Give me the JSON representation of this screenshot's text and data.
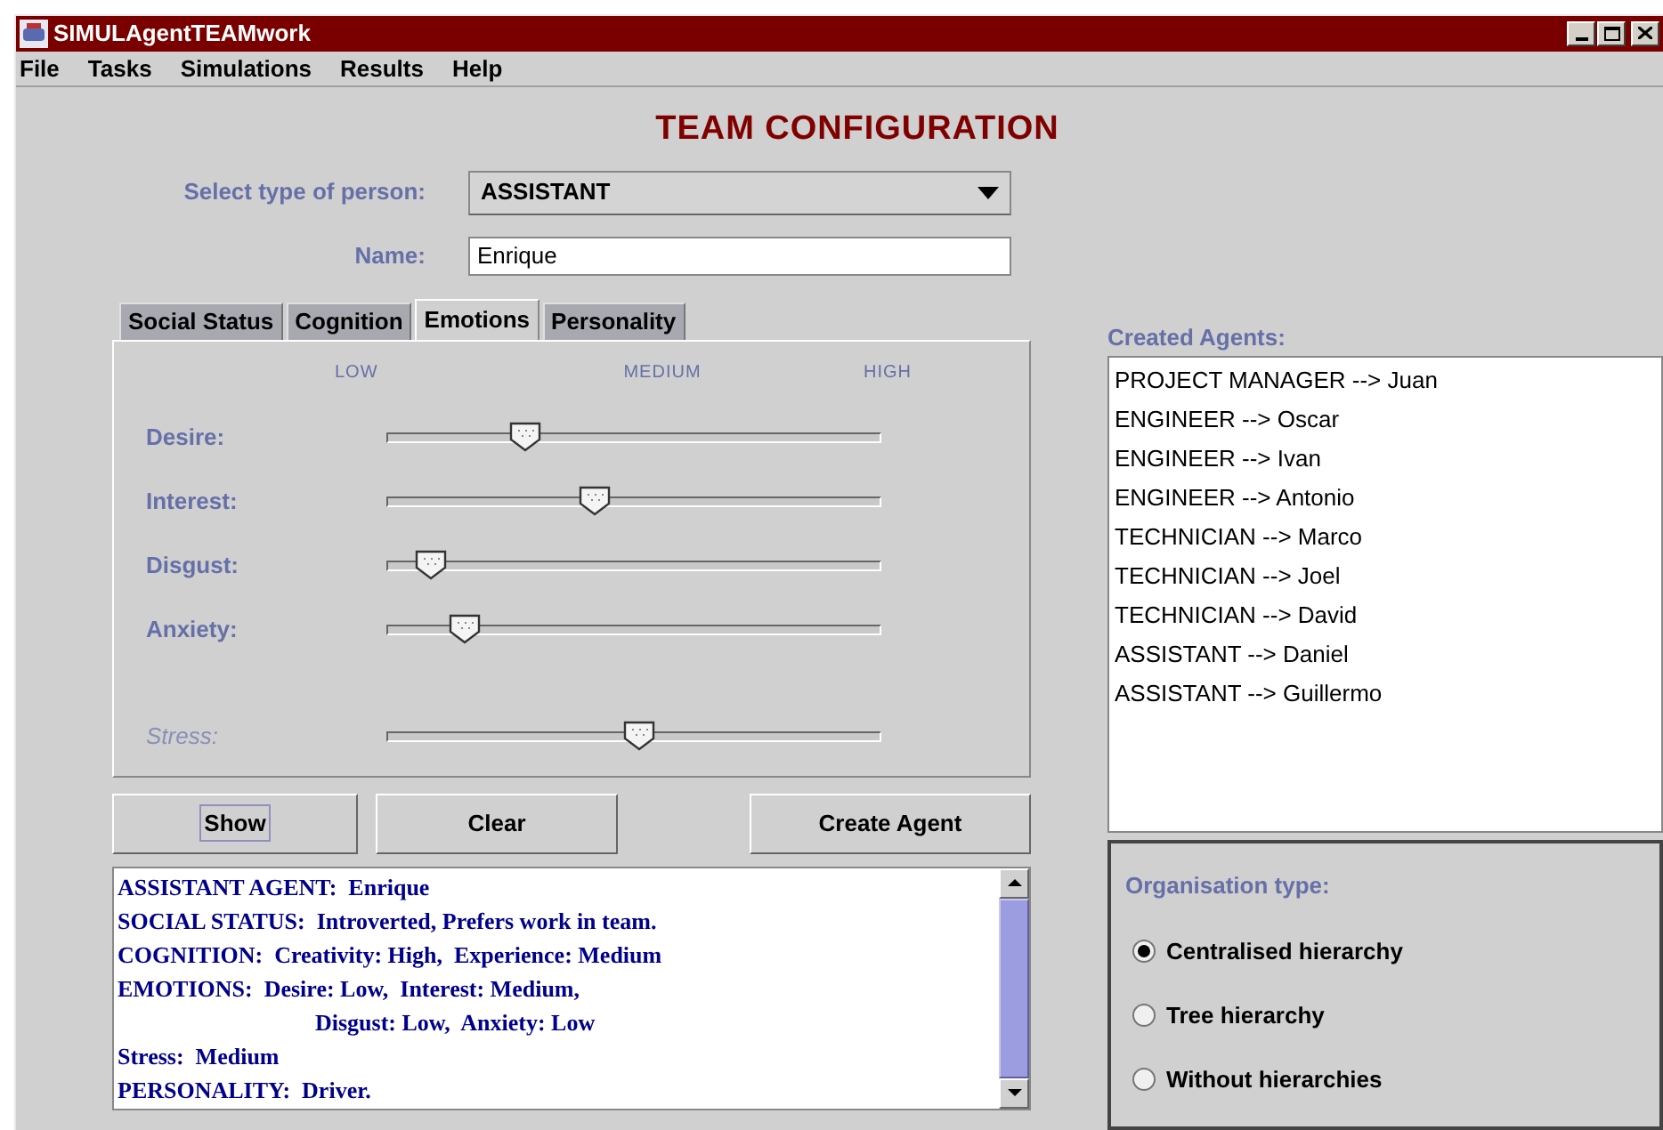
{
  "window": {
    "title": "SIMULAgentTEAMwork"
  },
  "menu": [
    "File",
    "Tasks",
    "Simulations",
    "Results",
    "Help"
  ],
  "heading": "TEAM CONFIGURATION",
  "person_type": {
    "label": "Select type of person:",
    "value": "ASSISTANT"
  },
  "name": {
    "label": "Name:",
    "value": "Enrique"
  },
  "tabs": [
    {
      "label": "Social Status",
      "selected": false
    },
    {
      "label": "Cognition",
      "selected": false
    },
    {
      "label": "Emotions",
      "selected": true
    },
    {
      "label": "Personality",
      "selected": false
    }
  ],
  "scale_labels": [
    "LOW",
    "MEDIUM",
    "HIGH"
  ],
  "sliders": [
    {
      "label": "Desire:",
      "level": 0.28,
      "disabled": false
    },
    {
      "label": "Interest:",
      "level": 0.42,
      "disabled": false
    },
    {
      "label": "Disgust:",
      "level": 0.09,
      "disabled": false
    },
    {
      "label": "Anxiety:",
      "level": 0.16,
      "disabled": false
    },
    {
      "label": "Stress:",
      "level": 0.51,
      "disabled": true
    }
  ],
  "buttons": [
    {
      "label": "Show",
      "focused": true
    },
    {
      "label": "Clear",
      "focused": false
    },
    {
      "label": "Create Agent",
      "focused": false
    }
  ],
  "summary": [
    {
      "text": "ASSISTANT AGENT:  Enrique",
      "kind": "line"
    },
    {
      "text": "SOCIAL STATUS:  Introverted, Prefers work in team.",
      "kind": "line"
    },
    {
      "text": "COGNITION:  Creativity: High,  Experience: Medium",
      "kind": "line"
    },
    {
      "text": "EMOTIONS:  Desire: Low,  Interest: Medium,",
      "kind": "line"
    },
    {
      "text": "Disgust: Low,  Anxiety: Low",
      "kind": "continuation"
    },
    {
      "text": "Stress:  Medium",
      "kind": "line"
    },
    {
      "text": "PERSONALITY:  Driver.",
      "kind": "line"
    }
  ],
  "created_agents": {
    "label": "Created Agents:",
    "items": [
      "PROJECT MANAGER --> Juan",
      "ENGINEER --> Oscar",
      "ENGINEER --> Ivan",
      "ENGINEER --> Antonio",
      "TECHNICIAN --> Marco",
      "TECHNICIAN --> Joel",
      "TECHNICIAN --> David",
      "ASSISTANT --> Daniel",
      "ASSISTANT --> Guillermo"
    ]
  },
  "organisation": {
    "label": "Organisation type:",
    "options": [
      {
        "label": "Centralised hierarchy",
        "selected": true
      },
      {
        "label": "Tree hierarchy",
        "selected": false
      },
      {
        "label": "Without hierarchies",
        "selected": false
      }
    ]
  }
}
